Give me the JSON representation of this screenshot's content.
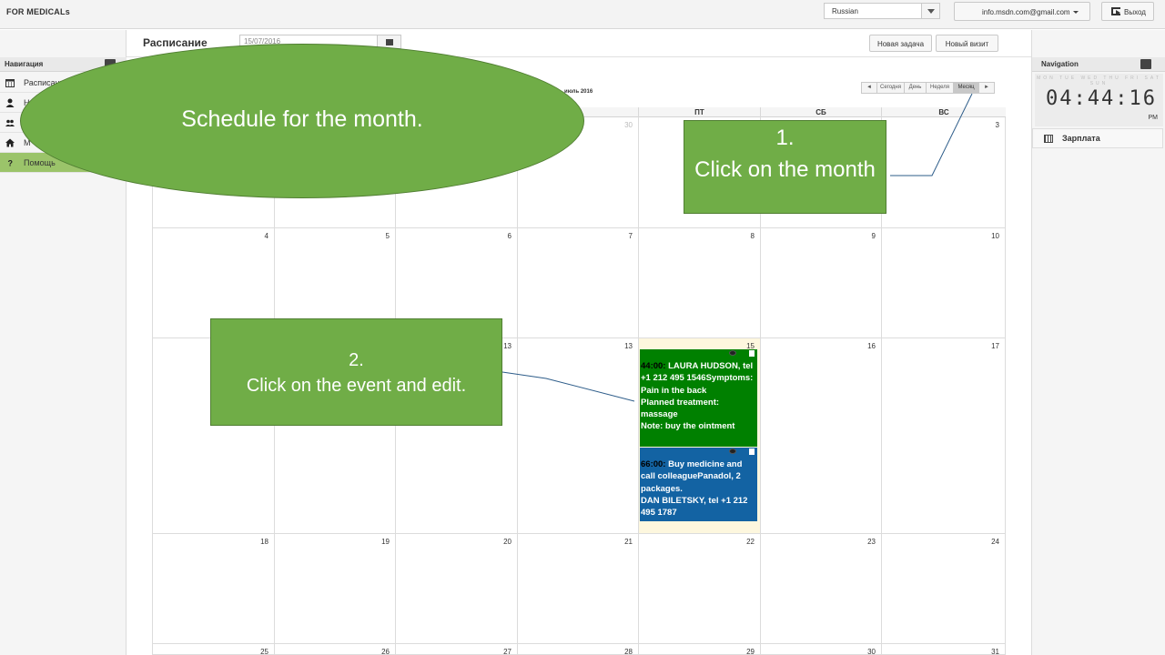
{
  "app": {
    "brand": "FOR MEDICALs"
  },
  "topbar": {
    "language": "Russian",
    "user_email": "info.msdn.com@gmail.com",
    "logout_label": "Выход"
  },
  "leftnav": {
    "title": "Навигация",
    "items": [
      {
        "label": "Расписание",
        "icon": "calendar-icon"
      },
      {
        "label": "Н",
        "icon": "person-icon"
      },
      {
        "label": "",
        "icon": "users-icon"
      },
      {
        "label": "М",
        "icon": "home-icon"
      },
      {
        "label": "Помощь",
        "icon": "help-icon"
      }
    ]
  },
  "main": {
    "title": "Расписание",
    "date_value": "15/07/2016",
    "new_task_label": "Новая задача",
    "new_visit_label": "Новый визит"
  },
  "calendar": {
    "month_title": "июль 2016",
    "nav_prev": "◄",
    "nav_next": "►",
    "today_label": "Сегодня",
    "view_day": "День",
    "view_week": "Неделя",
    "view_month": "Месяц",
    "active_view": "Месяц",
    "days_of_week": [
      "",
      "",
      "",
      "",
      "ПТ",
      "СБ",
      "ВС"
    ],
    "weeks": [
      {
        "days": [
          "",
          "",
          "",
          "30",
          "",
          "",
          "3"
        ]
      },
      {
        "days": [
          "4",
          "5",
          "6",
          "7",
          "8",
          "9",
          "10"
        ]
      },
      {
        "days": [
          "",
          "",
          "13",
          "13",
          "15",
          "16",
          "17"
        ]
      },
      {
        "days": [
          "18",
          "19",
          "20",
          "21",
          "22",
          "23",
          "24"
        ]
      },
      {
        "days": [
          "25",
          "26",
          "27",
          "28",
          "29",
          "30",
          "31"
        ]
      }
    ],
    "events": [
      {
        "time": "44:00:",
        "text": "LAURA HUDSON, tel +1 212 495 1546Symptoms: Pain in the back\nPlanned treatment: massage\nNote: buy the ointment",
        "color": "#008000"
      },
      {
        "time": "66:00:",
        "text": "Buy medicine and call colleaguePanadol, 2 packages.\nDAN BILETSKY, tel +1 212 495 1787",
        "color": "#1363a3"
      }
    ]
  },
  "rightpanel": {
    "title": "Navigation",
    "clock_days": "MON TUE WED THU FRI SAT SUN",
    "clock_active_day": "FRI",
    "clock_time": "04:44:16",
    "clock_ampm": "PM",
    "salary_label": "Зарплата"
  },
  "annotations": {
    "ellipse_text": "Schedule for the month.",
    "step1_number": "1.",
    "step1_text": "Click on the month",
    "step2_number": "2.",
    "step2_text": "Click on the event and edit."
  },
  "colors": {
    "callout_green": "#70ad47",
    "event_green": "#008000",
    "event_blue": "#1363a3",
    "help_item": "#9bc46a",
    "today_cell": "#fdf7de"
  }
}
